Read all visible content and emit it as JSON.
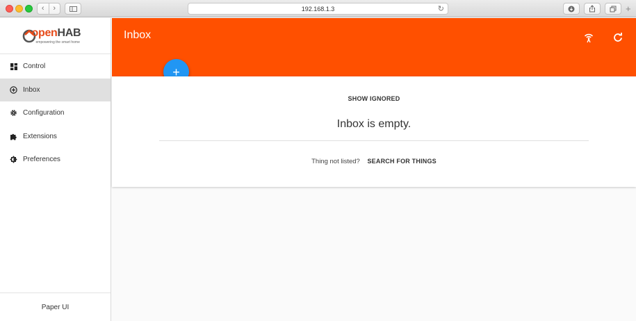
{
  "browser": {
    "url": "192.168.1.3"
  },
  "sidebar": {
    "logo": {
      "text_prefix": "open",
      "text_suffix": "HAB",
      "tagline": "empowering the smart home"
    },
    "items": [
      {
        "label": "Control",
        "icon": "dashboard-icon"
      },
      {
        "label": "Inbox",
        "icon": "add-circle-icon",
        "active": true
      },
      {
        "label": "Configuration",
        "icon": "gear-icon"
      },
      {
        "label": "Extensions",
        "icon": "puzzle-icon"
      },
      {
        "label": "Preferences",
        "icon": "brightness-icon"
      }
    ],
    "footer": "Paper UI"
  },
  "header": {
    "title": "Inbox",
    "color": "#ff5000"
  },
  "fab": {
    "label": "+",
    "color": "#2196f3"
  },
  "main": {
    "show_ignored": "SHOW IGNORED",
    "empty_message": "Inbox is empty.",
    "not_listed": "Thing not listed?",
    "search_things": "SEARCH FOR THINGS"
  }
}
